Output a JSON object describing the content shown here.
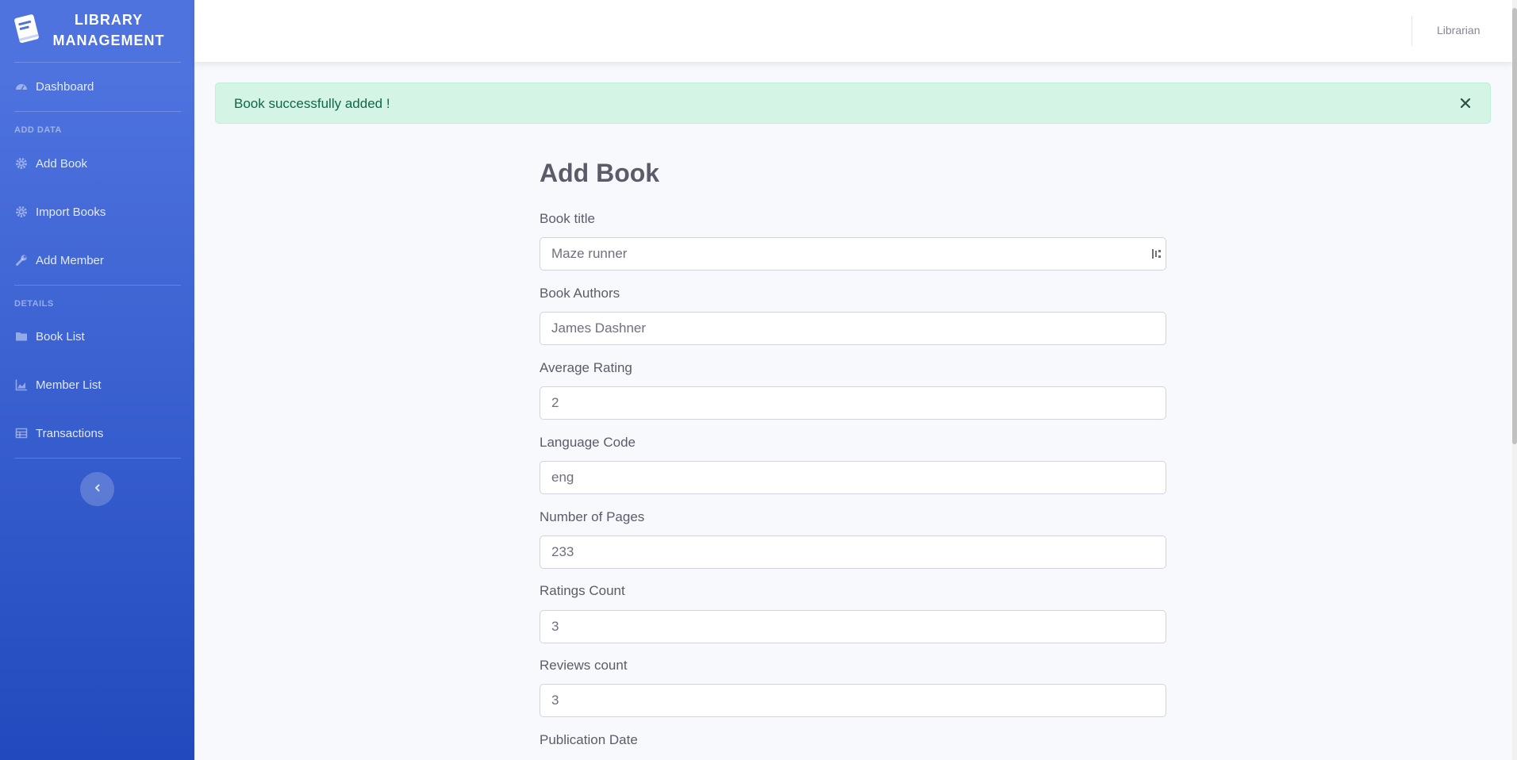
{
  "brand": {
    "line1": "LIBRARY",
    "line2": "MANAGEMENT",
    "icon": "book-icon"
  },
  "sidebar": {
    "dashboard": {
      "label": "Dashboard",
      "icon": "tachometer-icon"
    },
    "heading_add": "ADD DATA",
    "add_book": {
      "label": "Add Book",
      "icon": "cog-icon"
    },
    "import_books": {
      "label": "Import Books",
      "icon": "cog-icon"
    },
    "add_member": {
      "label": "Add Member",
      "icon": "wrench-icon"
    },
    "heading_details": "DETAILS",
    "book_list": {
      "label": "Book List",
      "icon": "folder-icon"
    },
    "member_list": {
      "label": "Member List",
      "icon": "chart-area-icon"
    },
    "transactions": {
      "label": "Transactions",
      "icon": "table-icon"
    },
    "toggle_icon": "chevron-left-icon"
  },
  "topbar": {
    "user": "Librarian"
  },
  "alert": {
    "message": "Book successfully added !",
    "close_icon": "close-icon"
  },
  "form": {
    "title": "Add Book",
    "fields": {
      "title": {
        "label": "Book title",
        "value": "Maze runner"
      },
      "authors": {
        "label": "Book Authors",
        "value": "James Dashner"
      },
      "rating": {
        "label": "Average Rating",
        "value": "2"
      },
      "language": {
        "label": "Language Code",
        "value": "eng"
      },
      "pages": {
        "label": "Number of Pages",
        "value": "233"
      },
      "ratings_count": {
        "label": "Ratings Count",
        "value": "3"
      },
      "reviews_count": {
        "label": "Reviews count",
        "value": "3"
      },
      "publication_date": {
        "label": "Publication Date"
      }
    }
  },
  "colors": {
    "sidebar_top": "#4e73df",
    "sidebar_bottom": "#224abe",
    "alert_bg": "#d4f4e6",
    "alert_text": "#0f6848"
  }
}
